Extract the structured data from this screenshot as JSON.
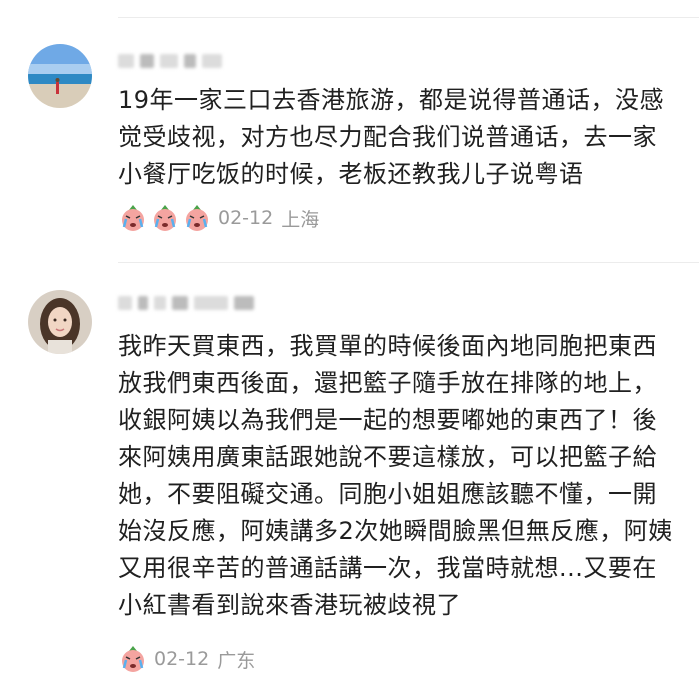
{
  "comments": [
    {
      "username": "",
      "text": "19年一家三口去香港旅游，都是说得普通话，没感觉受歧视，对方也尽力配合我们说普通话，去一家小餐厅吃饭的时候，老板还教我儿子说粤语",
      "reactions": [
        "crying-face-emoji",
        "crying-face-emoji",
        "crying-face-emoji"
      ],
      "date": "02-12",
      "location": "上海"
    },
    {
      "username": "",
      "text": "我昨天買東西，我買單的時候後面內地同胞把東西放我們東西後面，還把籃子隨手放在排隊的地上，收銀阿姨以為我們是一起的想要嘟她的東西了！後來阿姨用廣東話跟她說不要這樣放，可以把籃子給她，不要阻礙交通。同胞小姐姐應該聽不懂，一開始沒反應，阿姨講多2次她瞬間臉黑但無反應，阿姨又用很辛苦的普通話講一次，我當時就想...又要在小紅書看到說來香港玩被歧視了",
      "reactions": [
        "crying-face-emoji"
      ],
      "date": "02-12",
      "location": "广东"
    }
  ]
}
